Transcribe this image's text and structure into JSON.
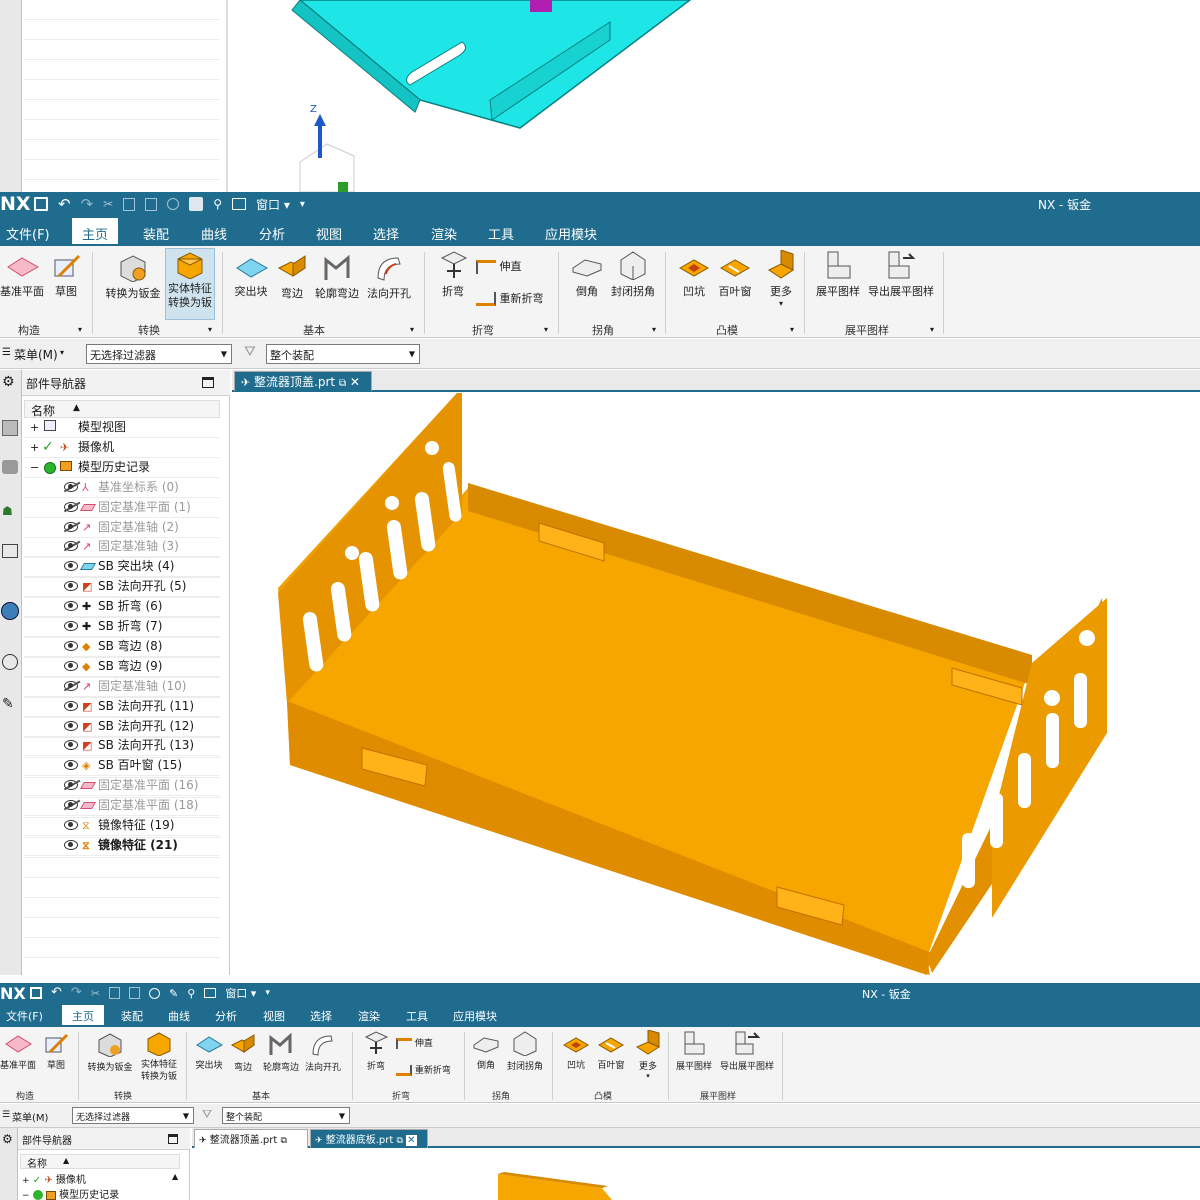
{
  "window_title": "NX - 钣金",
  "menu": [
    "文件(F)",
    "主页",
    "装配",
    "曲线",
    "分析",
    "视图",
    "选择",
    "渲染",
    "工具",
    "应用模块"
  ],
  "ribbon": {
    "buttons": [
      "基准平面",
      "草图",
      "转换为钣金",
      "实体特征\n转换为钣",
      "突出块",
      "弯边",
      "轮廓弯边",
      "法向开孔",
      "折弯",
      "伸直",
      "重新折弯",
      "倒角",
      "封闭拐角",
      "凹坑",
      "百叶窗",
      "更多",
      "展平图样",
      "导出展平图样"
    ],
    "groups": [
      "构造",
      "转换",
      "基本",
      "折弯",
      "拐角",
      "凸模",
      "展平图样"
    ]
  },
  "selection": {
    "menu_label": "菜单(M)",
    "filter": "无选择过滤器",
    "scope": "整个装配"
  },
  "nav": {
    "title": "部件导航器",
    "col_name": "名称",
    "rows": [
      {
        "label": "模型视图",
        "state": "normal",
        "indent": 0
      },
      {
        "label": "摄像机",
        "state": "normal",
        "indent": 0
      },
      {
        "label": "模型历史记录",
        "state": "normal",
        "indent": 0
      },
      {
        "label": "基准坐标系 (0)",
        "state": "gray",
        "indent": 1
      },
      {
        "label": "固定基准平面 (1)",
        "state": "gray",
        "indent": 1
      },
      {
        "label": "固定基准轴 (2)",
        "state": "gray",
        "indent": 1
      },
      {
        "label": "固定基准轴 (3)",
        "state": "gray",
        "indent": 1
      },
      {
        "label": "SB 突出块 (4)",
        "state": "normal",
        "indent": 1
      },
      {
        "label": "SB 法向开孔 (5)",
        "state": "normal",
        "indent": 1
      },
      {
        "label": "SB 折弯 (6)",
        "state": "normal",
        "indent": 1
      },
      {
        "label": "SB 折弯 (7)",
        "state": "normal",
        "indent": 1
      },
      {
        "label": "SB 弯边 (8)",
        "state": "normal",
        "indent": 1
      },
      {
        "label": "SB 弯边 (9)",
        "state": "normal",
        "indent": 1
      },
      {
        "label": "固定基准轴 (10)",
        "state": "gray",
        "indent": 1
      },
      {
        "label": "SB 法向开孔 (11)",
        "state": "normal",
        "indent": 1
      },
      {
        "label": "SB 法向开孔 (12)",
        "state": "normal",
        "indent": 1
      },
      {
        "label": "SB 法向开孔 (13)",
        "state": "normal",
        "indent": 1
      },
      {
        "label": "SB 百叶窗 (15)",
        "state": "normal",
        "indent": 1
      },
      {
        "label": "固定基准平面 (16)",
        "state": "gray",
        "indent": 1
      },
      {
        "label": "固定基准平面 (18)",
        "state": "gray",
        "indent": 1
      },
      {
        "label": "镜像特征 (19)",
        "state": "normal",
        "indent": 1
      },
      {
        "label": "镜像特征 (21)",
        "state": "bold",
        "indent": 1
      }
    ]
  },
  "tabs": {
    "main_tab": "整流器顶盖.prt",
    "bottom_tab1": "整流器顶盖.prt",
    "bottom_tab2": "整流器底板.prt"
  },
  "bottom_nav": {
    "title": "部件导航器",
    "col_name": "名称",
    "rows": [
      "摄像机",
      "模型历史记录"
    ]
  },
  "colors": {
    "titlebar": "#1f6c8e",
    "part_orange": "#f7a600",
    "part_cyan": "#1ee6e6"
  },
  "axis_label": "Z"
}
